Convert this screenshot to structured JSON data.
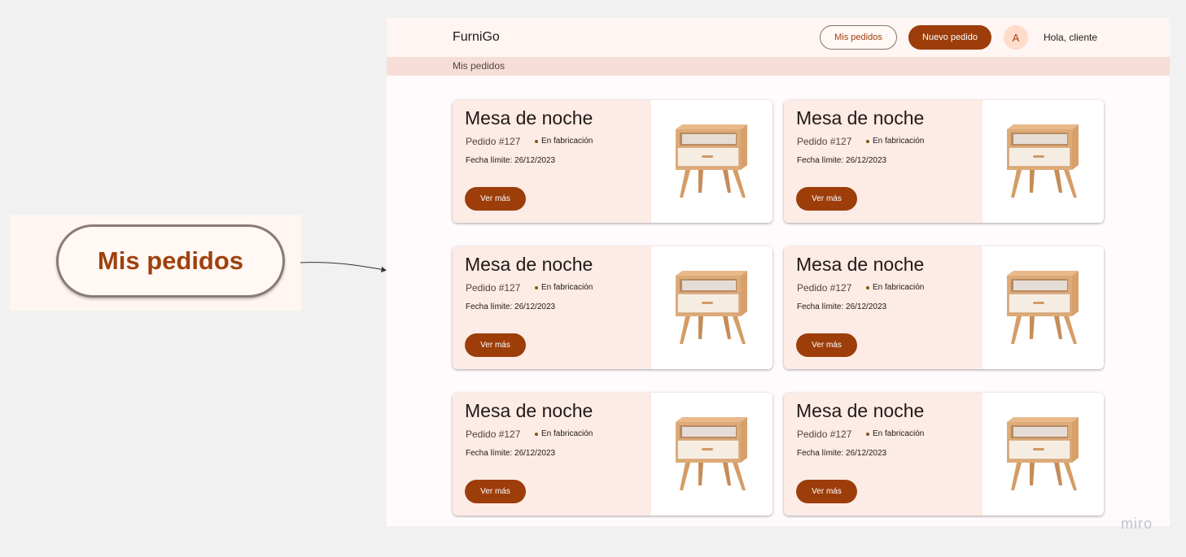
{
  "zoom_callout": {
    "label": "Mis pedidos"
  },
  "header": {
    "brand": "FurniGo",
    "my_orders_button": "Mis pedidos",
    "new_order_button": "Nuevo pedido",
    "avatar_initial": "A",
    "greeting": "Hola, cliente"
  },
  "breadcrumb": {
    "current": "Mis pedidos"
  },
  "orders": [
    {
      "title": "Mesa de noche",
      "order_number": "Pedido #127",
      "status": "En fabricación",
      "deadline": "Fecha límite: 26/12/2023",
      "button": "Ver más",
      "image_icon": "nightstand-icon"
    },
    {
      "title": "Mesa de noche",
      "order_number": "Pedido #127",
      "status": "En fabricación",
      "deadline": "Fecha límite: 26/12/2023",
      "button": "Ver más",
      "image_icon": "nightstand-icon"
    },
    {
      "title": "Mesa de noche",
      "order_number": "Pedido #127",
      "status": "En fabricación",
      "deadline": "Fecha límite: 26/12/2023",
      "button": "Ver más",
      "image_icon": "nightstand-icon"
    },
    {
      "title": "Mesa de noche",
      "order_number": "Pedido #127",
      "status": "En fabricación",
      "deadline": "Fecha límite: 26/12/2023",
      "button": "Ver más",
      "image_icon": "nightstand-icon"
    },
    {
      "title": "Mesa de noche",
      "order_number": "Pedido #127",
      "status": "En fabricación",
      "deadline": "Fecha límite: 26/12/2023",
      "button": "Ver más",
      "image_icon": "nightstand-icon"
    },
    {
      "title": "Mesa de noche",
      "order_number": "Pedido #127",
      "status": "En fabricación",
      "deadline": "Fecha límite: 26/12/2023",
      "button": "Ver más",
      "image_icon": "nightstand-icon"
    }
  ],
  "watermark": "miro",
  "colors": {
    "primary": "#9c3d0a",
    "header_bg": "#fff5f2",
    "breadcrumb_bg": "#f6ddd5",
    "card_panel": "#fdebe5"
  }
}
